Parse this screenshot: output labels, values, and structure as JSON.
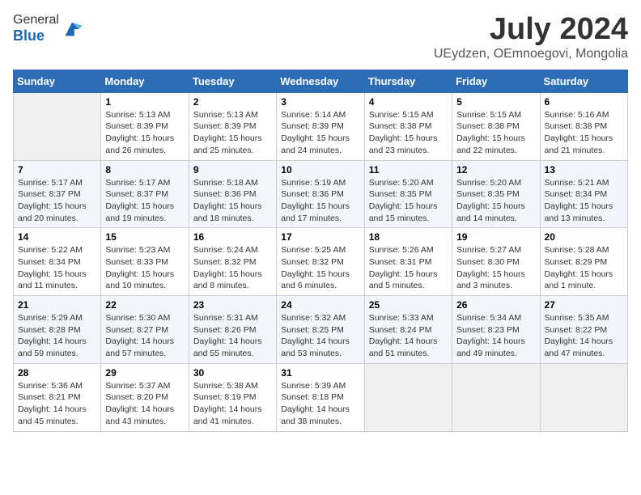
{
  "header": {
    "logo_line1": "General",
    "logo_line2": "Blue",
    "title": "July 2024",
    "subtitle": "UEydzen, OEmnoegovi, Mongolia"
  },
  "days_of_week": [
    "Sunday",
    "Monday",
    "Tuesday",
    "Wednesday",
    "Thursday",
    "Friday",
    "Saturday"
  ],
  "weeks": [
    [
      {
        "day": "",
        "info": ""
      },
      {
        "day": "1",
        "info": "Sunrise: 5:13 AM\nSunset: 8:39 PM\nDaylight: 15 hours\nand 26 minutes."
      },
      {
        "day": "2",
        "info": "Sunrise: 5:13 AM\nSunset: 8:39 PM\nDaylight: 15 hours\nand 25 minutes."
      },
      {
        "day": "3",
        "info": "Sunrise: 5:14 AM\nSunset: 8:39 PM\nDaylight: 15 hours\nand 24 minutes."
      },
      {
        "day": "4",
        "info": "Sunrise: 5:15 AM\nSunset: 8:38 PM\nDaylight: 15 hours\nand 23 minutes."
      },
      {
        "day": "5",
        "info": "Sunrise: 5:15 AM\nSunset: 8:38 PM\nDaylight: 15 hours\nand 22 minutes."
      },
      {
        "day": "6",
        "info": "Sunrise: 5:16 AM\nSunset: 8:38 PM\nDaylight: 15 hours\nand 21 minutes."
      }
    ],
    [
      {
        "day": "7",
        "info": "Sunrise: 5:17 AM\nSunset: 8:37 PM\nDaylight: 15 hours\nand 20 minutes."
      },
      {
        "day": "8",
        "info": "Sunrise: 5:17 AM\nSunset: 8:37 PM\nDaylight: 15 hours\nand 19 minutes."
      },
      {
        "day": "9",
        "info": "Sunrise: 5:18 AM\nSunset: 8:36 PM\nDaylight: 15 hours\nand 18 minutes."
      },
      {
        "day": "10",
        "info": "Sunrise: 5:19 AM\nSunset: 8:36 PM\nDaylight: 15 hours\nand 17 minutes."
      },
      {
        "day": "11",
        "info": "Sunrise: 5:20 AM\nSunset: 8:35 PM\nDaylight: 15 hours\nand 15 minutes."
      },
      {
        "day": "12",
        "info": "Sunrise: 5:20 AM\nSunset: 8:35 PM\nDaylight: 15 hours\nand 14 minutes."
      },
      {
        "day": "13",
        "info": "Sunrise: 5:21 AM\nSunset: 8:34 PM\nDaylight: 15 hours\nand 13 minutes."
      }
    ],
    [
      {
        "day": "14",
        "info": "Sunrise: 5:22 AM\nSunset: 8:34 PM\nDaylight: 15 hours\nand 11 minutes."
      },
      {
        "day": "15",
        "info": "Sunrise: 5:23 AM\nSunset: 8:33 PM\nDaylight: 15 hours\nand 10 minutes."
      },
      {
        "day": "16",
        "info": "Sunrise: 5:24 AM\nSunset: 8:32 PM\nDaylight: 15 hours\nand 8 minutes."
      },
      {
        "day": "17",
        "info": "Sunrise: 5:25 AM\nSunset: 8:32 PM\nDaylight: 15 hours\nand 6 minutes."
      },
      {
        "day": "18",
        "info": "Sunrise: 5:26 AM\nSunset: 8:31 PM\nDaylight: 15 hours\nand 5 minutes."
      },
      {
        "day": "19",
        "info": "Sunrise: 5:27 AM\nSunset: 8:30 PM\nDaylight: 15 hours\nand 3 minutes."
      },
      {
        "day": "20",
        "info": "Sunrise: 5:28 AM\nSunset: 8:29 PM\nDaylight: 15 hours\nand 1 minute."
      }
    ],
    [
      {
        "day": "21",
        "info": "Sunrise: 5:29 AM\nSunset: 8:28 PM\nDaylight: 14 hours\nand 59 minutes."
      },
      {
        "day": "22",
        "info": "Sunrise: 5:30 AM\nSunset: 8:27 PM\nDaylight: 14 hours\nand 57 minutes."
      },
      {
        "day": "23",
        "info": "Sunrise: 5:31 AM\nSunset: 8:26 PM\nDaylight: 14 hours\nand 55 minutes."
      },
      {
        "day": "24",
        "info": "Sunrise: 5:32 AM\nSunset: 8:25 PM\nDaylight: 14 hours\nand 53 minutes."
      },
      {
        "day": "25",
        "info": "Sunrise: 5:33 AM\nSunset: 8:24 PM\nDaylight: 14 hours\nand 51 minutes."
      },
      {
        "day": "26",
        "info": "Sunrise: 5:34 AM\nSunset: 8:23 PM\nDaylight: 14 hours\nand 49 minutes."
      },
      {
        "day": "27",
        "info": "Sunrise: 5:35 AM\nSunset: 8:22 PM\nDaylight: 14 hours\nand 47 minutes."
      }
    ],
    [
      {
        "day": "28",
        "info": "Sunrise: 5:36 AM\nSunset: 8:21 PM\nDaylight: 14 hours\nand 45 minutes."
      },
      {
        "day": "29",
        "info": "Sunrise: 5:37 AM\nSunset: 8:20 PM\nDaylight: 14 hours\nand 43 minutes."
      },
      {
        "day": "30",
        "info": "Sunrise: 5:38 AM\nSunset: 8:19 PM\nDaylight: 14 hours\nand 41 minutes."
      },
      {
        "day": "31",
        "info": "Sunrise: 5:39 AM\nSunset: 8:18 PM\nDaylight: 14 hours\nand 38 minutes."
      },
      {
        "day": "",
        "info": ""
      },
      {
        "day": "",
        "info": ""
      },
      {
        "day": "",
        "info": ""
      }
    ]
  ]
}
